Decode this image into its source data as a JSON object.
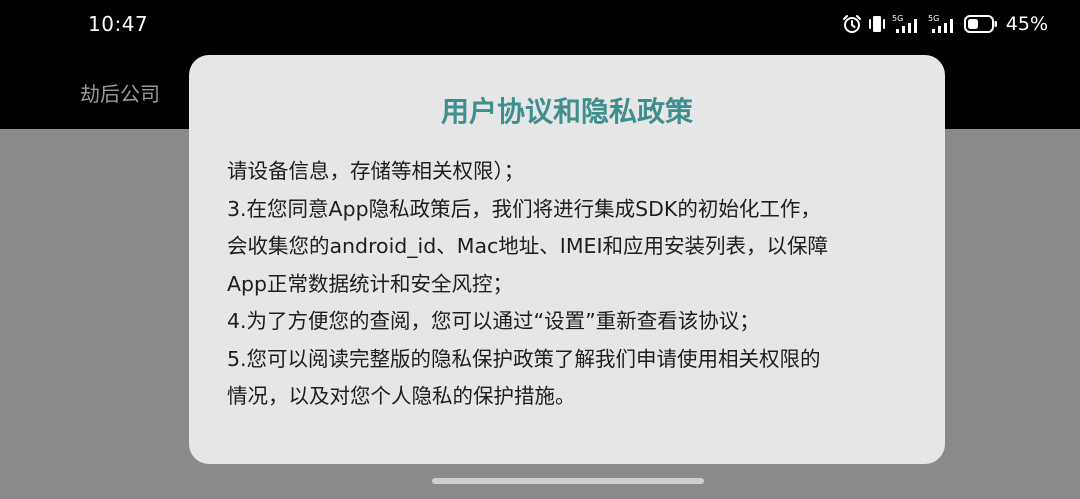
{
  "status_bar": {
    "time": "10:47",
    "signal_1_label": "5G",
    "signal_2_label": "5G",
    "battery_percent": "45%",
    "battery_level": 0.45,
    "icons": [
      "alarm-icon",
      "vibrate-icon",
      "signal-5g-icon",
      "signal-5g-icon",
      "battery-icon"
    ]
  },
  "app_bar": {
    "title": "劫后公司"
  },
  "dialog": {
    "title": "用户协议和隐私政策",
    "lines": [
      "请设备信息，存储等相关权限）；",
      "3.在您同意App隐私政策后，我们将进行集成SDK的初始化工作，",
      "会收集您的android_id、Mac地址、IMEI和应用安装列表，以保障",
      "App正常数据统计和安全风控；",
      "4.为了方便您的查阅，您可以通过“设置”重新查看该协议；",
      "5.您可以阅读完整版的隐私保护政策了解我们申请使用相关权限的",
      "情况，以及对您个人隐私的保护措施。"
    ]
  },
  "colors": {
    "title_accent": "#3f8f8f",
    "dialog_bg": "#e6e6e6",
    "scrim": "#8a8a8a",
    "top_bar": "#000000"
  }
}
